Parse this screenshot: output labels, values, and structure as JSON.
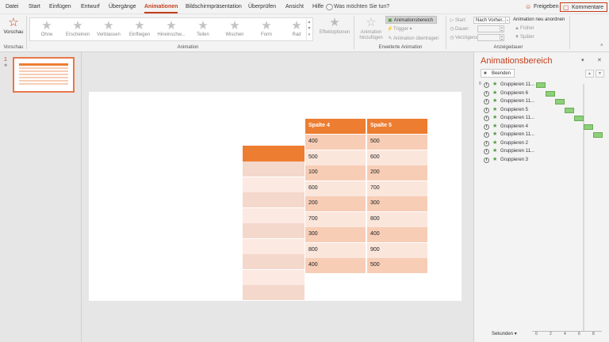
{
  "menu": {
    "tabs": [
      {
        "label": "Datei",
        "active": false
      },
      {
        "label": "Start",
        "active": false
      },
      {
        "label": "Einfügen",
        "active": false
      },
      {
        "label": "Entwurf",
        "active": false
      },
      {
        "label": "Übergänge",
        "active": false
      },
      {
        "label": "Animationen",
        "active": true
      },
      {
        "label": "Bildschirmpräsentation",
        "active": false
      },
      {
        "label": "Überprüfen",
        "active": false
      },
      {
        "label": "Ansicht",
        "active": false
      },
      {
        "label": "Hilfe",
        "active": false
      }
    ],
    "search_icon": "lightbulb-icon",
    "search_text": "Was möchten Sie tun?",
    "share_label": "Freigeben",
    "comments_label": "Kommentare",
    "accent_color": "#c43e1c"
  },
  "ribbon": {
    "preview_label": "Vorschau",
    "preview_group": "Vorschau",
    "animations": [
      "Ohne",
      "Erscheinen",
      "Verblassen",
      "Einfliegen",
      "Hineinschw...",
      "Teilen",
      "Wischen",
      "Form",
      "Rad"
    ],
    "effect_options": "Effektoptionen",
    "animation_group": "Animation",
    "add_animation": [
      "Animation",
      "hinzufügen"
    ],
    "animation_pane": "Animationsbereich",
    "trigger": "Trigger",
    "animation_painter": "Animation übertragen",
    "advanced_group": "Erweiterte Animation",
    "start_label": "Start:",
    "start_value": "Nach Vorher...",
    "duration_label": "Dauer:",
    "delay_label": "Verzögerung:",
    "timing_group": "Anzeigedauer",
    "reorder_title": "Animation neu anordnen",
    "move_earlier": "Früher",
    "move_later": "Später"
  },
  "thumbnails": {
    "slide_number": "1"
  },
  "slide": {
    "header_color": "#ed7d31",
    "col4_header": "Spalte 4",
    "col5_header": "Spalte 5",
    "col4_values": [
      "400",
      "500",
      "100",
      "600",
      "200",
      "700",
      "300",
      "800",
      "400"
    ],
    "col5_values": [
      "500",
      "600",
      "200",
      "700",
      "300",
      "800",
      "400",
      "900",
      "500"
    ]
  },
  "animation_pane": {
    "title": "Animationsbereich",
    "stop_label": "Beenden",
    "first_index": "0",
    "items": [
      {
        "name": "Gruppieren 11...",
        "bar_start": 0.0
      },
      {
        "name": "Gruppieren 6",
        "bar_start": 0.5
      },
      {
        "name": "Gruppieren 11...",
        "bar_start": 1.0
      },
      {
        "name": "Gruppieren 5",
        "bar_start": 1.5
      },
      {
        "name": "Gruppieren 11...",
        "bar_start": 2.0
      },
      {
        "name": "Gruppieren 4",
        "bar_start": 2.5
      },
      {
        "name": "Gruppieren 11...",
        "bar_start": 3.0
      },
      {
        "name": "Gruppieren 2",
        "bar_start": null
      },
      {
        "name": "Gruppieren 11...",
        "bar_start": null
      },
      {
        "name": "Gruppieren 3",
        "bar_start": null
      }
    ],
    "bar_color": "#8ecf7a",
    "seconds_label": "Sekunden",
    "scale": [
      "0",
      "2",
      "4",
      "6",
      "8"
    ]
  }
}
